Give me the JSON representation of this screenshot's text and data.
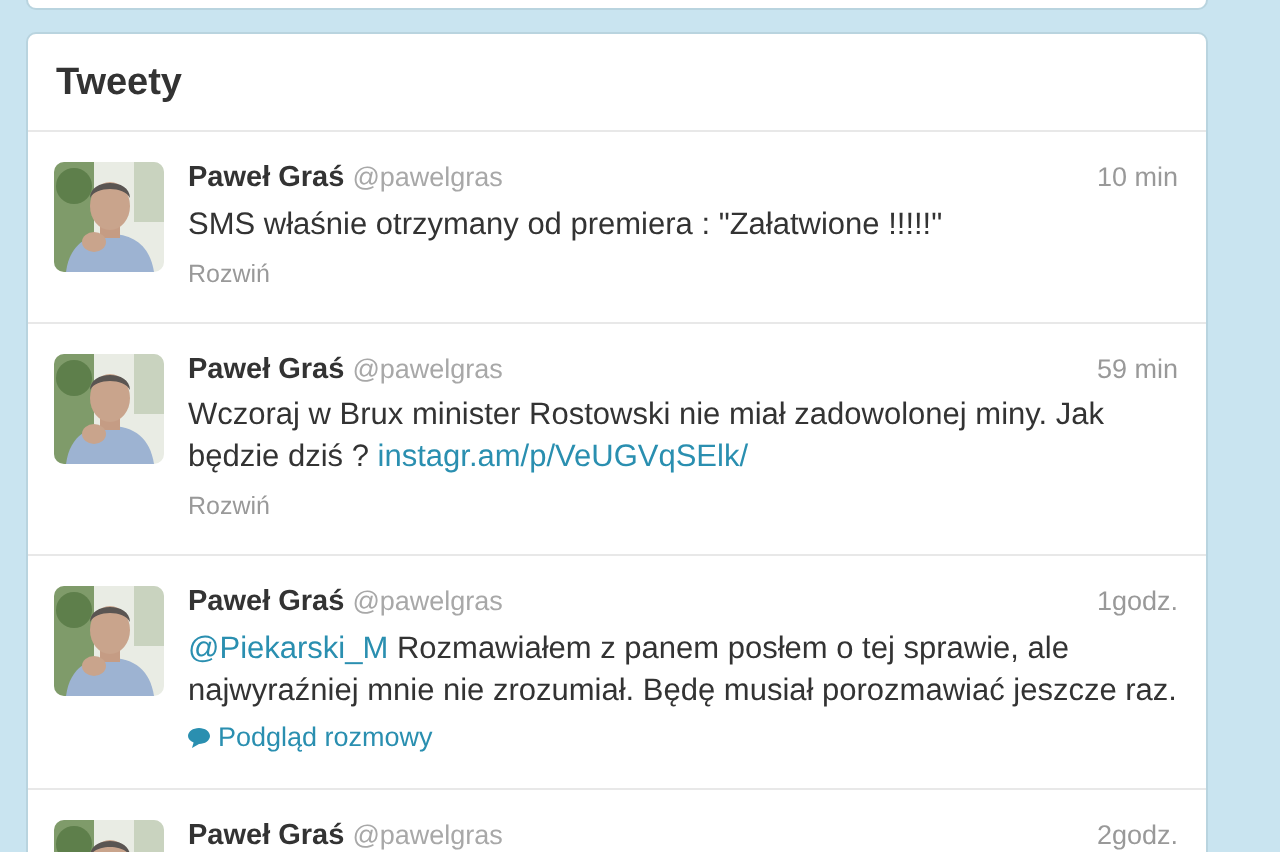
{
  "panel": {
    "title": "Tweety"
  },
  "tweets": [
    {
      "name": "Paweł Graś",
      "handle": "@pawelgras",
      "time": "10 min",
      "segments": [
        {
          "kind": "text",
          "text": "SMS właśnie otrzymany od premiera : \"Załatwione !!!!!\""
        }
      ],
      "action": {
        "kind": "expand",
        "label": "Rozwiń"
      }
    },
    {
      "name": "Paweł Graś",
      "handle": "@pawelgras",
      "time": "59 min",
      "segments": [
        {
          "kind": "text",
          "text": "Wczoraj w Brux minister Rostowski nie miał zadowolonej miny. Jak będzie dziś ? "
        },
        {
          "kind": "link",
          "text": "instagr.am/p/VeUGVqSElk/"
        }
      ],
      "action": {
        "kind": "expand",
        "label": "Rozwiń"
      }
    },
    {
      "name": "Paweł Graś",
      "handle": "@pawelgras",
      "time": "1godz.",
      "segments": [
        {
          "kind": "mention",
          "text": "@Piekarski_M"
        },
        {
          "kind": "text",
          "text": " Rozmawiałem z panem posłem o tej sprawie, ale najwyraźniej mnie nie zrozumiał. Będę musiał porozmawiać jeszcze raz."
        }
      ],
      "action": {
        "kind": "conversation",
        "label": "Podgląd rozmowy"
      }
    },
    {
      "name": "Paweł Graś",
      "handle": "@pawelgras",
      "time": "2godz."
    }
  ]
}
